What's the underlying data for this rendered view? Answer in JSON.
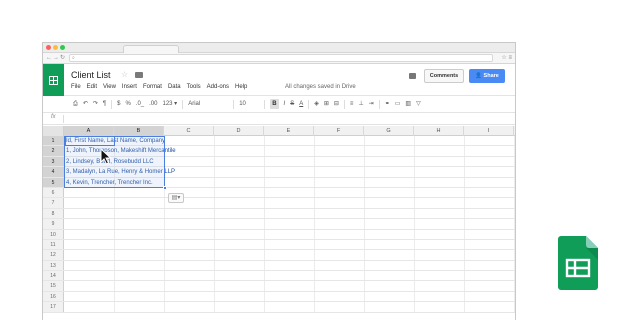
{
  "browser": {
    "url_text": "",
    "traffic_lights": [
      "#fc605c",
      "#fdbc40",
      "#34c84a"
    ]
  },
  "app": {
    "title": "Client List",
    "menu": [
      "File",
      "Edit",
      "View",
      "Insert",
      "Format",
      "Data",
      "Tools",
      "Add-ons",
      "Help"
    ],
    "save_status": "All changes saved in Drive",
    "comments_label": "Comments",
    "share_label": "Share",
    "accent": "#0f9d58",
    "share_color": "#4a8af4"
  },
  "toolbar": {
    "dollar": "$",
    "percent": "%",
    "decimal_less": ".0_",
    "decimal_more": ".00",
    "more_formats": "123 ▾",
    "font": "Arial",
    "font_size": "10",
    "bold": "B",
    "italic": "I",
    "strike": "S",
    "text_color": "A"
  },
  "formula_bar": {
    "fx": "fx"
  },
  "sheet": {
    "columns": [
      "A",
      "B",
      "C",
      "D",
      "E",
      "F",
      "G",
      "H",
      "I"
    ],
    "selected_columns": [
      "A",
      "B"
    ],
    "rows": [
      "1",
      "2",
      "3",
      "4",
      "5",
      "6",
      "7",
      "8",
      "9",
      "10",
      "11",
      "12",
      "13",
      "14",
      "15",
      "16",
      "17"
    ],
    "selected_rows": [
      "1",
      "2",
      "3",
      "4",
      "5"
    ],
    "cells": [
      "Id, First Name, Last Name, Company",
      "1, John, Thompson, Makeshift Mercantile",
      "2, Lindsey, Budd, Rosebudd LLC",
      "3, Madalyn, La Rue, Henry & Homer LLP",
      "4, Kevin, Trencher, Trencher Inc."
    ]
  }
}
